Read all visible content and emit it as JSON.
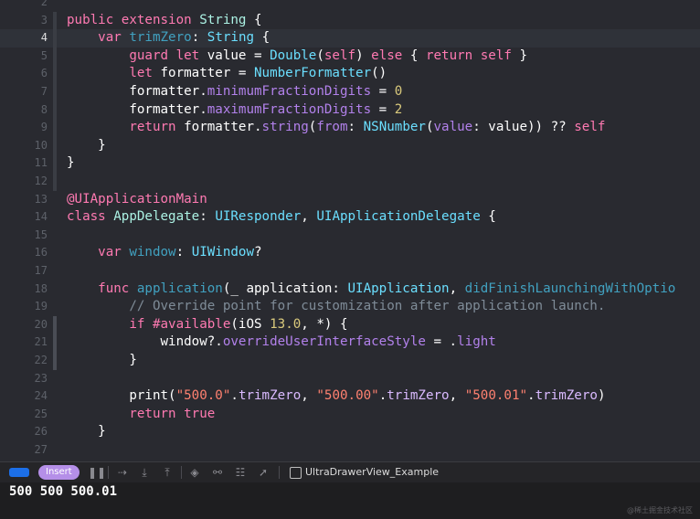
{
  "editor": {
    "current_line": "4",
    "lines": [
      {
        "num": "2",
        "code": []
      },
      {
        "num": "3",
        "code": [
          {
            "c": "t-kw",
            "t": "public extension "
          },
          {
            "c": "t-type",
            "t": "String"
          },
          {
            "c": "t-plain",
            "t": " {"
          }
        ]
      },
      {
        "num": "4",
        "code": [
          {
            "c": "t-kw",
            "t": "    var "
          },
          {
            "c": "t-decl",
            "t": "trimZero"
          },
          {
            "c": "t-plain",
            "t": ": "
          },
          {
            "c": "t-type2",
            "t": "String"
          },
          {
            "c": "t-plain",
            "t": " {"
          }
        ]
      },
      {
        "num": "5",
        "code": [
          {
            "c": "t-kw",
            "t": "        guard let "
          },
          {
            "c": "t-plain",
            "t": "value = "
          },
          {
            "c": "t-type2",
            "t": "Double"
          },
          {
            "c": "t-plain",
            "t": "("
          },
          {
            "c": "t-kw",
            "t": "self"
          },
          {
            "c": "t-plain",
            "t": ") "
          },
          {
            "c": "t-kw",
            "t": "else"
          },
          {
            "c": "t-plain",
            "t": " { "
          },
          {
            "c": "t-kw",
            "t": "return self"
          },
          {
            "c": "t-plain",
            "t": " }"
          }
        ]
      },
      {
        "num": "6",
        "code": [
          {
            "c": "t-kw",
            "t": "        let "
          },
          {
            "c": "t-plain",
            "t": "formatter = "
          },
          {
            "c": "t-type2",
            "t": "NumberFormatter"
          },
          {
            "c": "t-plain",
            "t": "()"
          }
        ]
      },
      {
        "num": "7",
        "code": [
          {
            "c": "t-plain",
            "t": "        formatter."
          },
          {
            "c": "t-method",
            "t": "minimumFractionDigits"
          },
          {
            "c": "t-plain",
            "t": " = "
          },
          {
            "c": "t-num",
            "t": "0"
          }
        ]
      },
      {
        "num": "8",
        "code": [
          {
            "c": "t-plain",
            "t": "        formatter."
          },
          {
            "c": "t-method",
            "t": "maximumFractionDigits"
          },
          {
            "c": "t-plain",
            "t": " = "
          },
          {
            "c": "t-num",
            "t": "2"
          }
        ]
      },
      {
        "num": "9",
        "code": [
          {
            "c": "t-kw",
            "t": "        return "
          },
          {
            "c": "t-plain",
            "t": "formatter."
          },
          {
            "c": "t-method",
            "t": "string"
          },
          {
            "c": "t-plain",
            "t": "("
          },
          {
            "c": "t-method",
            "t": "from"
          },
          {
            "c": "t-plain",
            "t": ": "
          },
          {
            "c": "t-type2",
            "t": "NSNumber"
          },
          {
            "c": "t-plain",
            "t": "("
          },
          {
            "c": "t-method",
            "t": "value"
          },
          {
            "c": "t-plain",
            "t": ": value)) ?? "
          },
          {
            "c": "t-kw",
            "t": "self"
          }
        ]
      },
      {
        "num": "10",
        "code": [
          {
            "c": "t-plain",
            "t": "    }"
          }
        ]
      },
      {
        "num": "11",
        "code": [
          {
            "c": "t-plain",
            "t": "}"
          }
        ]
      },
      {
        "num": "12",
        "code": []
      },
      {
        "num": "13",
        "code": [
          {
            "c": "t-attr",
            "t": "@UIApplicationMain"
          }
        ]
      },
      {
        "num": "14",
        "code": [
          {
            "c": "t-kw",
            "t": "class "
          },
          {
            "c": "t-type",
            "t": "AppDelegate"
          },
          {
            "c": "t-plain",
            "t": ": "
          },
          {
            "c": "t-type2",
            "t": "UIResponder"
          },
          {
            "c": "t-plain",
            "t": ", "
          },
          {
            "c": "t-type2",
            "t": "UIApplicationDelegate"
          },
          {
            "c": "t-plain",
            "t": " {"
          }
        ]
      },
      {
        "num": "15",
        "code": []
      },
      {
        "num": "16",
        "code": [
          {
            "c": "t-kw",
            "t": "    var "
          },
          {
            "c": "t-decl",
            "t": "window"
          },
          {
            "c": "t-plain",
            "t": ": "
          },
          {
            "c": "t-type2",
            "t": "UIWindow"
          },
          {
            "c": "t-plain",
            "t": "?"
          }
        ]
      },
      {
        "num": "17",
        "code": []
      },
      {
        "num": "18",
        "code": [
          {
            "c": "t-kw",
            "t": "    func "
          },
          {
            "c": "t-decl",
            "t": "application"
          },
          {
            "c": "t-plain",
            "t": "(_ application: "
          },
          {
            "c": "t-type2",
            "t": "UIApplication"
          },
          {
            "c": "t-plain",
            "t": ", "
          },
          {
            "c": "t-decl",
            "t": "didFinishLaunchingWithOptio"
          }
        ]
      },
      {
        "num": "19",
        "code": [
          {
            "c": "t-cmt",
            "t": "        // Override point for customization after application launch."
          }
        ]
      },
      {
        "num": "20",
        "code": [
          {
            "c": "t-kw",
            "t": "        if "
          },
          {
            "c": "t-kw",
            "t": "#available"
          },
          {
            "c": "t-plain",
            "t": "(iOS "
          },
          {
            "c": "t-num",
            "t": "13.0"
          },
          {
            "c": "t-plain",
            "t": ", *) {"
          }
        ]
      },
      {
        "num": "21",
        "code": [
          {
            "c": "t-plain",
            "t": "            window?."
          },
          {
            "c": "t-method",
            "t": "overrideUserInterfaceStyle"
          },
          {
            "c": "t-plain",
            "t": " = ."
          },
          {
            "c": "t-method",
            "t": "light"
          }
        ]
      },
      {
        "num": "22",
        "code": [
          {
            "c": "t-plain",
            "t": "        }"
          }
        ]
      },
      {
        "num": "23",
        "code": []
      },
      {
        "num": "24",
        "code": [
          {
            "c": "t-plain",
            "t": "        print("
          },
          {
            "c": "t-str",
            "t": "\"500.0\""
          },
          {
            "c": "t-plain",
            "t": "."
          },
          {
            "c": "t-ident",
            "t": "trimZero"
          },
          {
            "c": "t-plain",
            "t": ", "
          },
          {
            "c": "t-str",
            "t": "\"500.00\""
          },
          {
            "c": "t-plain",
            "t": "."
          },
          {
            "c": "t-ident",
            "t": "trimZero"
          },
          {
            "c": "t-plain",
            "t": ", "
          },
          {
            "c": "t-str",
            "t": "\"500.01\""
          },
          {
            "c": "t-plain",
            "t": "."
          },
          {
            "c": "t-ident",
            "t": "trimZero"
          },
          {
            "c": "t-plain",
            "t": ")"
          }
        ]
      },
      {
        "num": "25",
        "code": [
          {
            "c": "t-kw",
            "t": "        return true"
          }
        ]
      },
      {
        "num": "26",
        "code": [
          {
            "c": "t-plain",
            "t": "    }"
          }
        ]
      },
      {
        "num": "27",
        "code": []
      }
    ]
  },
  "debugbar": {
    "mode_badge": "Insert",
    "target_name": "UltraDrawerView_Example",
    "icons": [
      "console-toggle-icon",
      "pause-icon",
      "step-over-icon",
      "step-into-icon",
      "step-out-icon",
      "view-debugger-icon",
      "memory-graph-icon",
      "environment-overrides-icon",
      "location-icon",
      "target-icon"
    ]
  },
  "console": {
    "output": "500 500 500.01"
  },
  "watermark": "@稀土掘金技术社区"
}
